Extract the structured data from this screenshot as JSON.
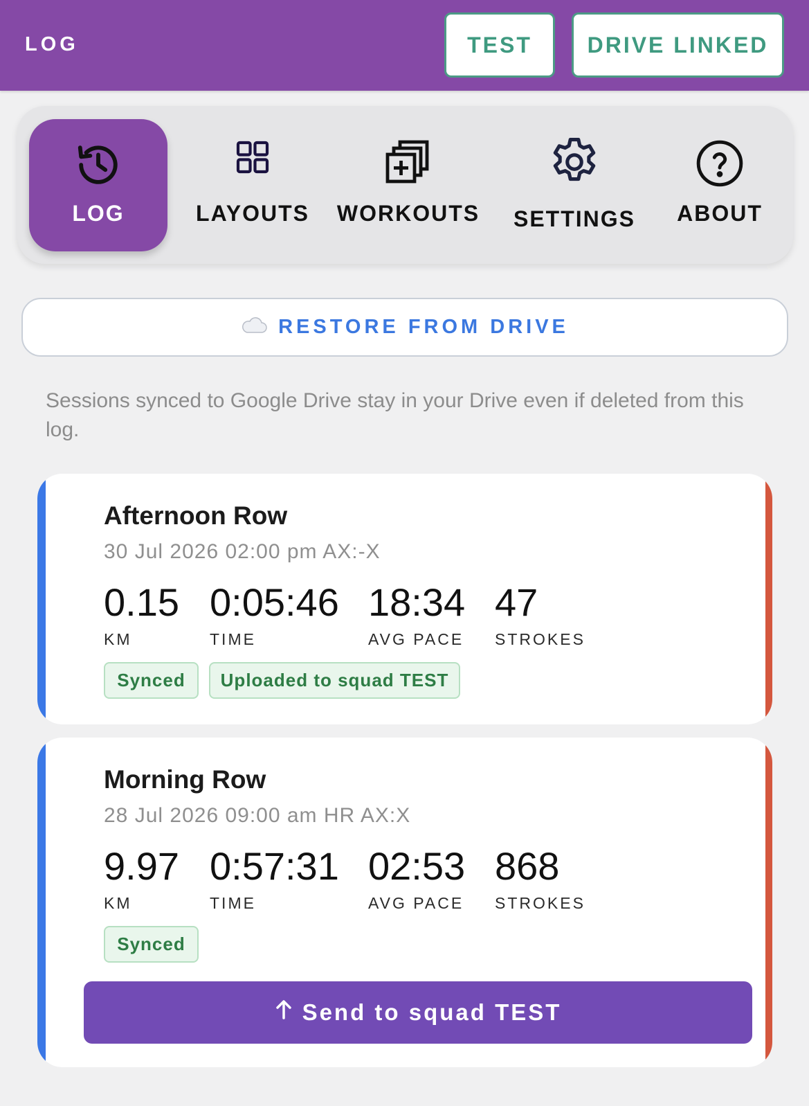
{
  "appbar": {
    "title": "LOG",
    "test_button": "TEST",
    "drive_button": "DRIVE LINKED",
    "bg_color": "#8549a6",
    "accent_color": "#3f9a80"
  },
  "tabs": [
    {
      "label": "LOG",
      "icon": "history-icon",
      "active": true
    },
    {
      "label": "LAYOUTS",
      "icon": "grid-icon",
      "active": false
    },
    {
      "label": "WORKOUTS",
      "icon": "stacked-add-icon",
      "active": false
    },
    {
      "label": "SETTINGS",
      "icon": "gear-icon",
      "active": false
    },
    {
      "label": "ABOUT",
      "icon": "help-circle-icon",
      "active": false
    }
  ],
  "restore": {
    "icon": "cloud-icon",
    "label": "RESTORE FROM DRIVE"
  },
  "info_text": "Sessions synced to Google Drive stay in your Drive even if deleted from this log.",
  "sessions": [
    {
      "title": "Afternoon Row",
      "meta": "30 Jul 2026 02:00 pm  AX:-X",
      "stats": [
        {
          "value": "0.15",
          "label": "KM"
        },
        {
          "value": "0:05:46",
          "label": "TIME"
        },
        {
          "value": "18:34",
          "label": "AVG PACE"
        },
        {
          "value": "47",
          "label": "STROKES"
        }
      ],
      "badges": [
        "Synced",
        "Uploaded to squad TEST"
      ]
    },
    {
      "title": "Morning Row",
      "meta": "28 Jul 2026 09:00 am  HR AX:X",
      "stats": [
        {
          "value": "9.97",
          "label": "KM"
        },
        {
          "value": "0:57:31",
          "label": "TIME"
        },
        {
          "value": "02:53",
          "label": "AVG PACE"
        },
        {
          "value": "868",
          "label": "STROKES"
        }
      ],
      "badges": [
        "Synced"
      ],
      "send_button": "Send to squad TEST"
    }
  ]
}
